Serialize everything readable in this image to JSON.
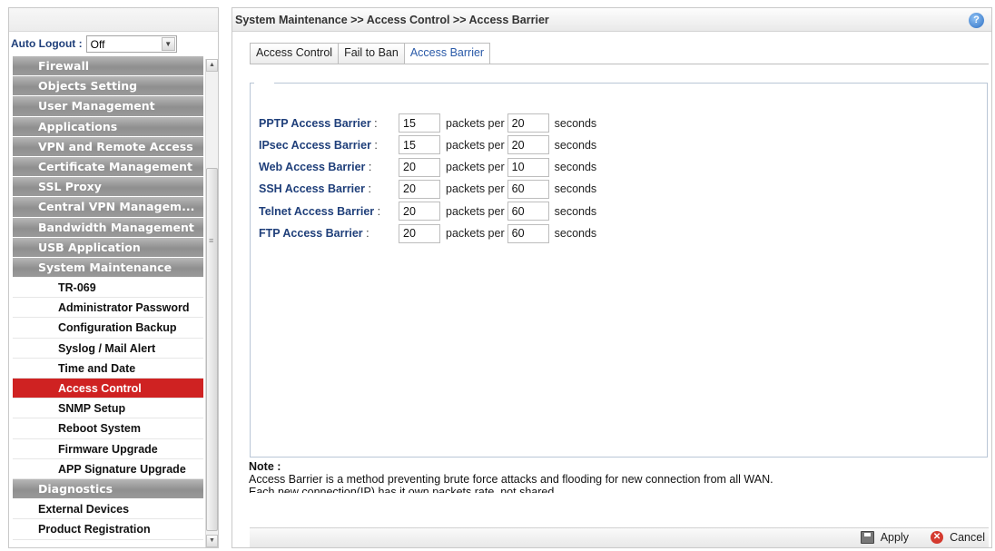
{
  "sidebar": {
    "auto_logout_label": "Auto Logout",
    "auto_logout_value": "Off",
    "menu": [
      {
        "label": "Firewall",
        "kind": "group"
      },
      {
        "label": "Objects Setting",
        "kind": "group"
      },
      {
        "label": "User Management",
        "kind": "group"
      },
      {
        "label": "Applications",
        "kind": "group"
      },
      {
        "label": "VPN and Remote Access",
        "kind": "group"
      },
      {
        "label": "Certificate Management",
        "kind": "group"
      },
      {
        "label": "SSL Proxy",
        "kind": "group"
      },
      {
        "label": "Central VPN Managem...",
        "kind": "group"
      },
      {
        "label": "Bandwidth Management",
        "kind": "group"
      },
      {
        "label": "USB Application",
        "kind": "group"
      },
      {
        "label": "System Maintenance",
        "kind": "group"
      },
      {
        "label": "TR-069",
        "kind": "sub"
      },
      {
        "label": "Administrator Password",
        "kind": "sub"
      },
      {
        "label": "Configuration Backup",
        "kind": "sub"
      },
      {
        "label": "Syslog / Mail Alert",
        "kind": "sub"
      },
      {
        "label": "Time and Date",
        "kind": "sub"
      },
      {
        "label": "Access Control",
        "kind": "sub-active"
      },
      {
        "label": "SNMP Setup",
        "kind": "sub"
      },
      {
        "label": "Reboot System",
        "kind": "sub"
      },
      {
        "label": "Firmware Upgrade",
        "kind": "sub"
      },
      {
        "label": "APP Signature Upgrade",
        "kind": "sub"
      },
      {
        "label": "Diagnostics",
        "kind": "group"
      },
      {
        "label": "External Devices",
        "kind": "plain"
      },
      {
        "label": "Product Registration",
        "kind": "plain"
      }
    ]
  },
  "header": {
    "breadcrumb": "System Maintenance >> Access Control >> Access Barrier",
    "help_icon": "help-icon"
  },
  "tabs": [
    {
      "label": "Access Control",
      "active": false
    },
    {
      "label": "Fail to Ban",
      "active": false
    },
    {
      "label": "Access Barrier",
      "active": true
    }
  ],
  "barriers": [
    {
      "label": "PPTP Access Barrier",
      "packets": "15",
      "per": "20"
    },
    {
      "label": "IPsec Access Barrier",
      "packets": "15",
      "per": "20"
    },
    {
      "label": "Web Access Barrier",
      "packets": "20",
      "per": "10"
    },
    {
      "label": "SSH Access Barrier",
      "packets": "20",
      "per": "60"
    },
    {
      "label": "Telnet Access Barrier",
      "packets": "20",
      "per": "60"
    },
    {
      "label": "FTP Access Barrier",
      "packets": "20",
      "per": "60"
    }
  ],
  "text": {
    "colon": " :",
    "packets_per": "packets per",
    "seconds": "seconds"
  },
  "note": {
    "title": "Note :",
    "line1": "Access Barrier is a method preventing brute force attacks and flooding for new connection from all WAN.",
    "line2": "Each new connection(IP) has it own packets rate, not shared."
  },
  "actions": {
    "apply": "Apply",
    "cancel": "Cancel"
  },
  "colors": {
    "active_menu": "#cf2222",
    "label_blue": "#1f3f7a",
    "tab_active": "#2a5aa8"
  }
}
